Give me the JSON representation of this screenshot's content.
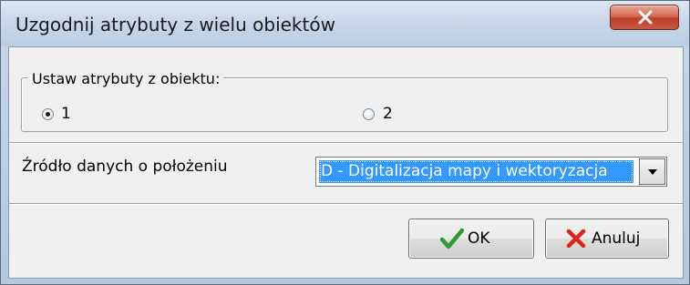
{
  "window": {
    "title": "Uzgodnij atrybuty z wielu obiektów",
    "close_icon": "close-x-icon"
  },
  "group": {
    "legend": "Ustaw atrybuty z obiektu:",
    "options": [
      {
        "label": "1",
        "checked": true
      },
      {
        "label": "2",
        "checked": false
      }
    ]
  },
  "source": {
    "label": "Źródło danych o położeniu",
    "selected": "D - Digitalizacja mapy i wektoryzacja"
  },
  "buttons": {
    "ok": {
      "label": "OK",
      "icon": "green-checkmark-icon"
    },
    "cancel": {
      "label": "Anuluj",
      "icon": "red-x-icon"
    }
  },
  "colors": {
    "selection": "#3399ff",
    "ok_icon": "#2e9b2e",
    "cancel_icon": "#d8261d"
  }
}
